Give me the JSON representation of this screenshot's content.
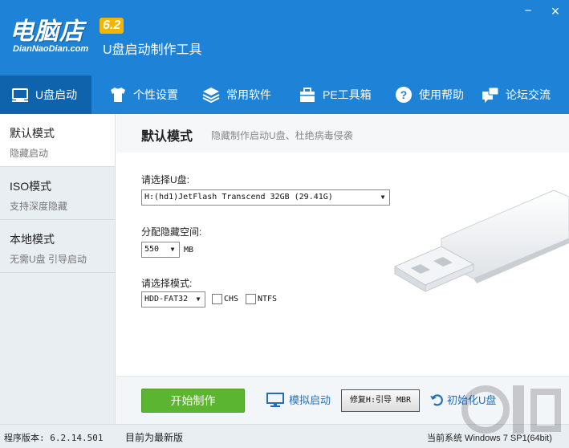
{
  "app": {
    "logo_main": "电脑店",
    "logo_version": "6.2",
    "logo_domain": "DianNaoDian.com",
    "tagline": "U盘启动制作工具"
  },
  "window_controls": {
    "minimize": "−",
    "close": "×"
  },
  "nav": [
    {
      "label": "U盘启动",
      "icon": "usb-drive-icon",
      "active": true
    },
    {
      "label": "个性设置",
      "icon": "shirt-icon"
    },
    {
      "label": "常用软件",
      "icon": "layers-icon"
    },
    {
      "label": "PE工具箱",
      "icon": "toolbox-icon"
    },
    {
      "label": "使用帮助",
      "icon": "help-icon"
    },
    {
      "label": "论坛交流",
      "icon": "chat-icon"
    }
  ],
  "sidebar": [
    {
      "title": "默认模式",
      "desc": "隐藏启动",
      "active": true
    },
    {
      "title": "ISO模式",
      "desc": "支持深度隐藏"
    },
    {
      "title": "本地模式",
      "desc": "无需U盘 引导启动"
    }
  ],
  "mode": {
    "title": "默认模式",
    "subtitle": "隐藏制作启动U盘、杜绝病毒侵袭"
  },
  "form": {
    "usb_label": "请选择U盘:",
    "usb_value": "H:(hd1)JetFlash Transcend 32GB (29.41G)",
    "space_label": "分配隐藏空间:",
    "space_value": "550",
    "space_unit": "MB",
    "mode_label": "请选择模式:",
    "mode_value": "HDD-FAT32",
    "chs_label": "CHS",
    "ntfs_label": "NTFS"
  },
  "actions": {
    "start": "开始制作",
    "simulate": "模拟启动",
    "fix_mbr": "修复H:引导 MBR",
    "init": "初始化U盘"
  },
  "status": {
    "version": "程序版本: 6.2.14.501",
    "latest": "目前为最新版",
    "system": "当前系统 Windows 7 SP1(64bit)"
  },
  "colors": {
    "header_blue": "#1e82d6",
    "nav_active": "#0f63ad",
    "start_green": "#5cb531",
    "link_blue": "#1f6fc1"
  }
}
